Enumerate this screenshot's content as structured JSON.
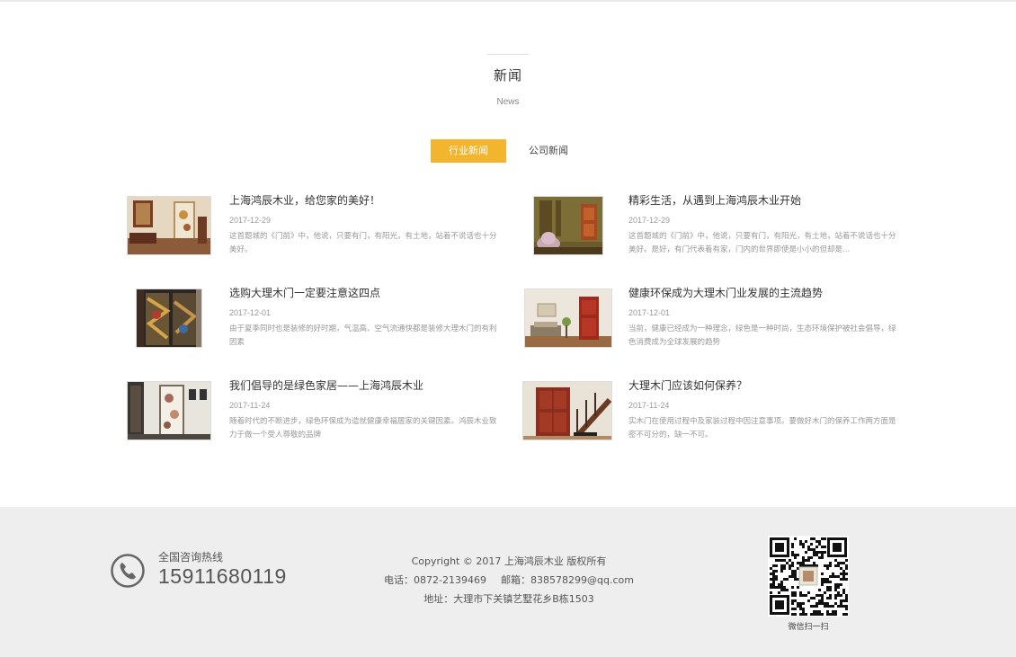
{
  "section": {
    "title": "新闻",
    "subtitle": "News"
  },
  "tabs": [
    {
      "label": "行业新闻",
      "active": true
    },
    {
      "label": "公司新闻",
      "active": false
    }
  ],
  "news": [
    {
      "title": "上海鸿辰木业，给您家的美好！",
      "date": "2017-12-29",
      "desc": "这首题城的《门前》中，他说，只要有门，有阳光，有土地，站着不说话也十分美好。"
    },
    {
      "title": "精彩生活，从遇到上海鸿辰木业开始",
      "date": "2017-12-29",
      "desc": "这首题城的《门前》中，他说，只要有门，有阳光，有土地，站着不说话也十分美好。是好，有门代表着有家，门内的世界即使是小小的但却是..."
    },
    {
      "title": "选购大理木门一定要注意这四点",
      "date": "2017-12-01",
      "desc": "由于夏季同时也是装修的好时期，气温高、空气流通快都是装修大理木门的有利因素"
    },
    {
      "title": "健康环保成为大理木门业发展的主流趋势",
      "date": "2017-12-01",
      "desc": "当前，健康已经成为一种理念，绿色是一种时尚，生态环境保护被社会倡导，绿色消费成为全球发展的趋势"
    },
    {
      "title": "我们倡导的是绿色家居——上海鸿辰木业",
      "date": "2017-11-24",
      "desc": "随着时代的不断进步，绿色环保成为造就健康幸福居家的关键因素。鸿辰木业致力于做一个受人尊敬的品牌"
    },
    {
      "title": "大理木门应该如何保养？",
      "date": "2017-11-24",
      "desc": "实木门在使用过程中及家装过程中因注意事项。要做好木门的保养工作两方面是密不可分的，缺一不可。"
    }
  ],
  "footer": {
    "hotline_label": "全国咨询热线",
    "hotline_number": "15911680119",
    "copyright": "Copyright © 2017 上海鸿辰木业 版权所有",
    "phone": "电话：0872-2139469",
    "email": "邮箱：838578299@qq.com",
    "address": "地址：大理市下关镇艺墅花乡B栋1503",
    "qr_label": "微信扫一扫"
  },
  "colors": {
    "accent": "#f3b42e",
    "footer_bg": "#eeeeee"
  }
}
